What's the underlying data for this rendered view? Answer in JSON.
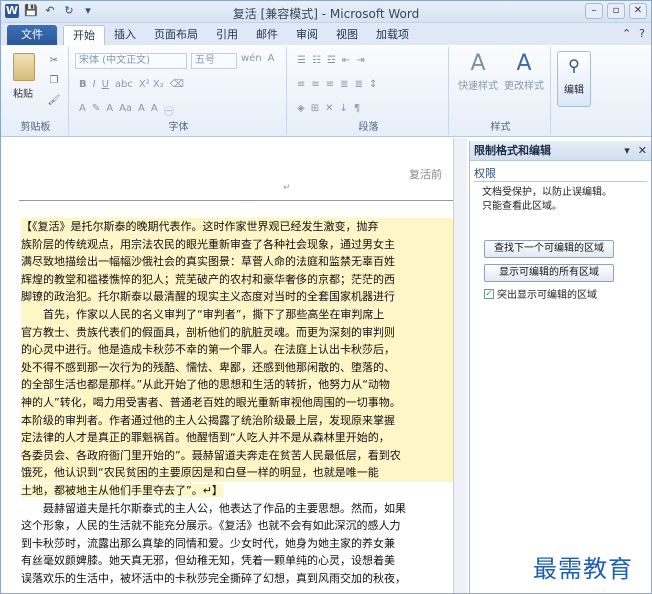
{
  "window": {
    "title": "复活 [兼容模式] - Microsoft Word"
  },
  "qat": {
    "logo": "W",
    "save": "💾",
    "undo": "↶",
    "redo": "↻",
    "customize": "▾"
  },
  "tabs": {
    "file": "文件",
    "items": [
      "开始",
      "插入",
      "页面布局",
      "引用",
      "邮件",
      "审阅",
      "视图",
      "加载项"
    ],
    "active": "开始"
  },
  "ribbon": {
    "clipboard": {
      "label": "剪贴板",
      "paste": "粘贴"
    },
    "font": {
      "label": "字体",
      "font_name": "宋体 (中文正文)",
      "font_size": "五号",
      "bold": "B",
      "italic": "I",
      "underline": "U",
      "grow": "A",
      "shrink": "A",
      "clear": "Aa",
      "sup_sub": "X² X₂",
      "phonetic": "wén",
      "char_border": "A",
      "text_effect": "A"
    },
    "paragraph": {
      "label": "段落"
    },
    "styles": {
      "label": "样式",
      "quick_styles": "快速样式",
      "change_styles": "更改样式"
    },
    "editing": {
      "label": "编辑",
      "edit": "编辑"
    }
  },
  "document": {
    "header_text": "复活前",
    "header_mark": "↵",
    "lines": [
      "【《复活》是托尔斯泰的晚期代表作。这时作家世界观已经发生激变，抛弃",
      "族阶层的传统观点，用宗法农民的眼光重新审查了各种社会现象，通过男女主",
      "满尽致地描绘出一幅幅沙俄社会的真实图景：草菅人命的法庭和监禁无辜百姓",
      "辉煌的教堂和褴褛憔悴的犯人；荒芜破产的农村和豪华奢侈的京都；茫茫的西",
      "脚镣的政治犯。托尔斯泰以最清醒的现实主义态度对当时的全套国家机器进行",
      "首先，作家以人民的名义审判了“审判者”，撕下了那些高坐在审判席上",
      "官方教士、贵族代表们的假面具，剖析他们的肮脏灵魂。而更为深刻的审判则",
      "的心灵中进行。他是造成卡秋莎不幸的第一个罪人。在法庭上认出卡秋莎后，",
      "处不得不感到那一次行为的残酷、懦怯、卑鄙，还感到他那闲散的、堕落的、",
      "的全部生活也都是那样。”从此开始了他的思想和生活的转折，他努力从“动物",
      "神的人”转化，喝力用受害者、普通老百姓的眼光重新审视他周围的一切事物。",
      "本阶级的审判者。作者通过他的主人公揭露了统治阶级最上层，发现原来掌握",
      "定法律的人才是真正的罪魁祸首。他醒悟到“人吃人并不是从森林里开始的，",
      "各委员会、各政府衙门里开始的”。聂赫留道夫奔走在贫苦人民最低层，看到农",
      "饿死，他认识到“农民贫困的主要原因是和白昼一样的明显，也就是唯一能",
      "土地，都被地主从他们手里夺去了”。↵】",
      "聂赫留道夫是托尔斯泰式的主人公，他表达了作品的主要思想。然而，如果",
      "这个形象，人民的生活就不能充分展示。《复活》也就不会有如此深沉的感人力",
      "到卡秋莎时，流露出那么真挚的同情和爱。少女时代，她身为她主家的养女兼",
      "有丝毫奴颜婢膝。她天真无邪，但幼稚无知，凭着一颗单纯的心灵，设想着美",
      "误落欢乐的生活中，被坏活中的卡秋莎完全撕碎了幻想，真到风雨交加的秋夜，"
    ]
  },
  "pane": {
    "title": "限制格式和编辑",
    "section": "权限",
    "desc1": "文档受保护，以防止误编辑。",
    "desc2": "只能查看此区域。",
    "btn_next": "查找下一个可编辑的区域",
    "btn_all": "显示可编辑的所有区域",
    "checkbox_label": "突出显示可编辑的区域",
    "checkbox_mark": "✓"
  },
  "watermark": "最需教育"
}
